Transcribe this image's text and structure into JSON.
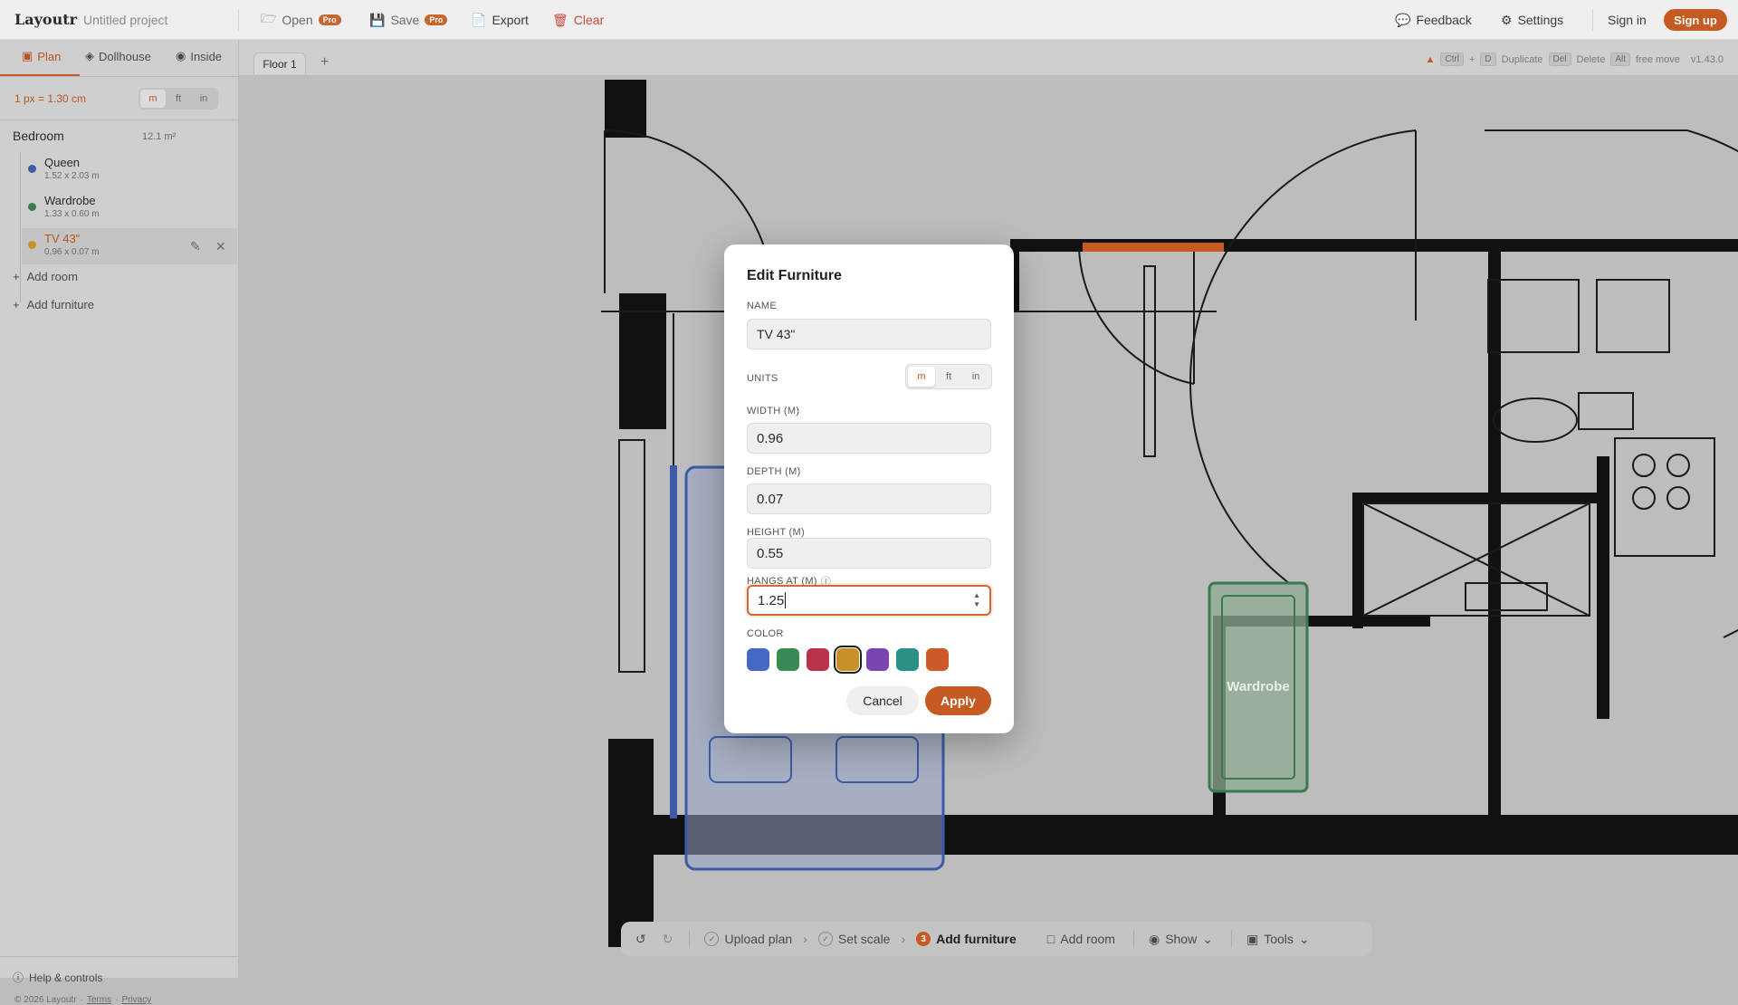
{
  "header": {
    "logo": "Layoutr",
    "project_name": "Untitled project",
    "open_label": "Open",
    "save_label": "Save",
    "pro_badge": "Pro",
    "export_label": "Export",
    "clear_label": "Clear",
    "feedback_label": "Feedback",
    "settings_label": "Settings",
    "signin_label": "Sign in",
    "signup_label": "Sign up"
  },
  "view_tabs": [
    {
      "label": "Plan",
      "icon": "plan-icon",
      "active": true
    },
    {
      "label": "Dollhouse",
      "icon": "cube-icon",
      "active": false
    },
    {
      "label": "Inside",
      "icon": "camera-icon",
      "active": false
    }
  ],
  "sidebar": {
    "scale_text": "1 px = 1.30 cm",
    "units": [
      "m",
      "ft",
      "in"
    ],
    "selected_unit": "m",
    "room": {
      "name": "Bedroom",
      "area": "12.1 m²"
    },
    "furniture": [
      {
        "name": "Queen",
        "dims": "1.52 x 2.03 m",
        "color": "#3d5ba8"
      },
      {
        "name": "Wardrobe",
        "dims": "1.33 x 0.60 m",
        "color": "#3b7a4f"
      },
      {
        "name": "TV 43\"",
        "dims": "0.96 x 0.07 m",
        "color": "#c89028",
        "selected": true
      }
    ],
    "add_room_label": "Add room",
    "add_furniture_label": "Add furniture",
    "help_label": "Help & controls",
    "copyright": "© 2026 Layoutr",
    "terms_label": "Terms",
    "privacy_label": "Privacy"
  },
  "floor_bar": {
    "floor_tab": "Floor 1",
    "add_floor": "+",
    "shortcut_ctrl": "Ctrl",
    "shortcut_d": "D",
    "duplicate_label": "Duplicate",
    "shortcut_del": "Del",
    "delete_label": "Delete",
    "shortcut_alt": "Alt",
    "free_move_label": "free move",
    "version": "v1.43.0"
  },
  "canvas": {
    "wardrobe_label": "Wardrobe"
  },
  "bottom_bar": {
    "upload_plan": "Upload plan",
    "set_scale": "Set scale",
    "step_number": "3",
    "add_furniture": "Add furniture",
    "add_room": "Add room",
    "show": "Show",
    "tools": "Tools"
  },
  "modal": {
    "title": "Edit Furniture",
    "name_label": "NAME",
    "name_value": "TV 43\"",
    "units_label": "UNITS",
    "units": [
      "m",
      "ft",
      "in"
    ],
    "selected_unit": "m",
    "width_label": "WIDTH (M)",
    "width_value": "0.96",
    "depth_label": "DEPTH (M)",
    "depth_value": "0.07",
    "height_label": "HEIGHT (M)",
    "height_value": "0.55",
    "hangs_label": "HANGS AT (M)",
    "hangs_value": "1.25",
    "color_label": "COLOR",
    "colors": [
      "#4468c4",
      "#3a8a55",
      "#b8334a",
      "#c89028",
      "#7a45b0",
      "#2b9088",
      "#cc5a2a"
    ],
    "selected_color_index": 3,
    "cancel_label": "Cancel",
    "apply_label": "Apply"
  }
}
